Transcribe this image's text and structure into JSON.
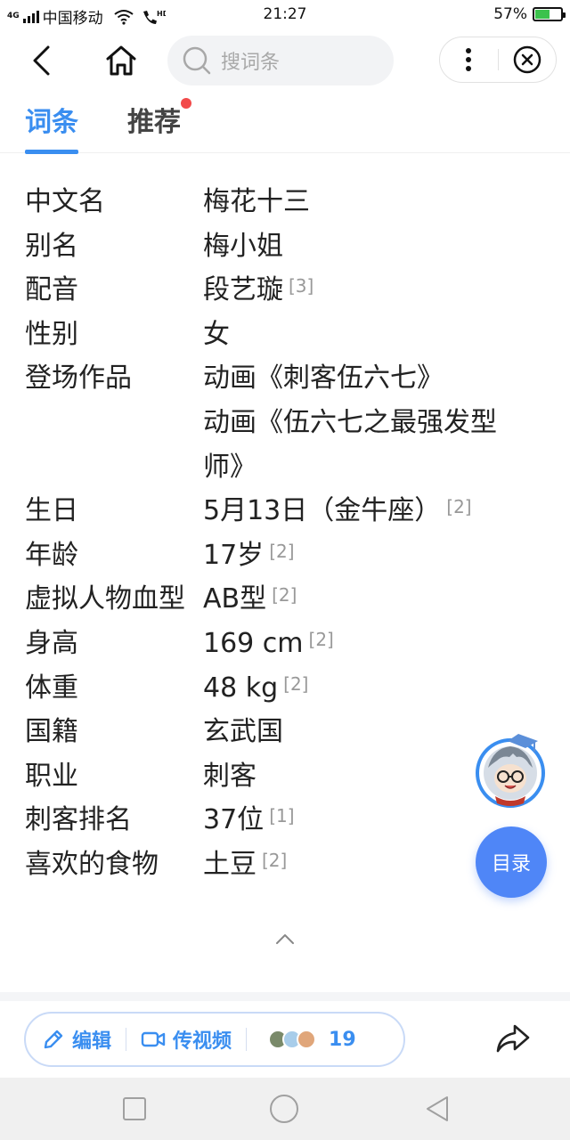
{
  "status_bar": {
    "network": "4G",
    "carrier": "中国移动",
    "time": "21:27",
    "battery_percent": "57%",
    "battery_level": 0.57
  },
  "search": {
    "placeholder": "搜词条"
  },
  "tabs": [
    {
      "label": "词条",
      "active": true
    },
    {
      "label": "推荐",
      "active": false,
      "has_dot": true
    }
  ],
  "info_rows": [
    {
      "key": "中文名",
      "value": "梅花十三"
    },
    {
      "key": "别名",
      "value": "梅小姐"
    },
    {
      "key": "配音",
      "value": "段艺璇",
      "ref": "[3]"
    },
    {
      "key": "性别",
      "value": "女"
    },
    {
      "key": "登场作品",
      "value_lines": [
        "动画《刺客伍六七》",
        "动画《伍六七之最强发型",
        "师》"
      ]
    },
    {
      "key": "生日",
      "value": "5月13日（金牛座）",
      "ref": "[2]"
    },
    {
      "key": "年龄",
      "value": "17岁",
      "ref": "[2]"
    },
    {
      "key": "虚拟人物血型",
      "value": "AB型",
      "ref": "[2]"
    },
    {
      "key": "身高",
      "value": "169 cm",
      "ref": "[2]"
    },
    {
      "key": "体重",
      "value": "48 kg",
      "ref": "[2]"
    },
    {
      "key": "国籍",
      "value": "玄武国"
    },
    {
      "key": "职业",
      "value": "刺客"
    },
    {
      "key": "刺客排名",
      "value": "37位",
      "ref": "[1]"
    },
    {
      "key": "喜欢的食物",
      "value": "土豆",
      "ref": "[2]"
    }
  ],
  "toc_label": "目录",
  "actions": {
    "edit": "编辑",
    "video": "传视频",
    "contributors_count": "19"
  },
  "colors": {
    "accent": "#3a8ef0",
    "toc_button": "#4f86f7",
    "notify_dot": "#f24a4a"
  }
}
